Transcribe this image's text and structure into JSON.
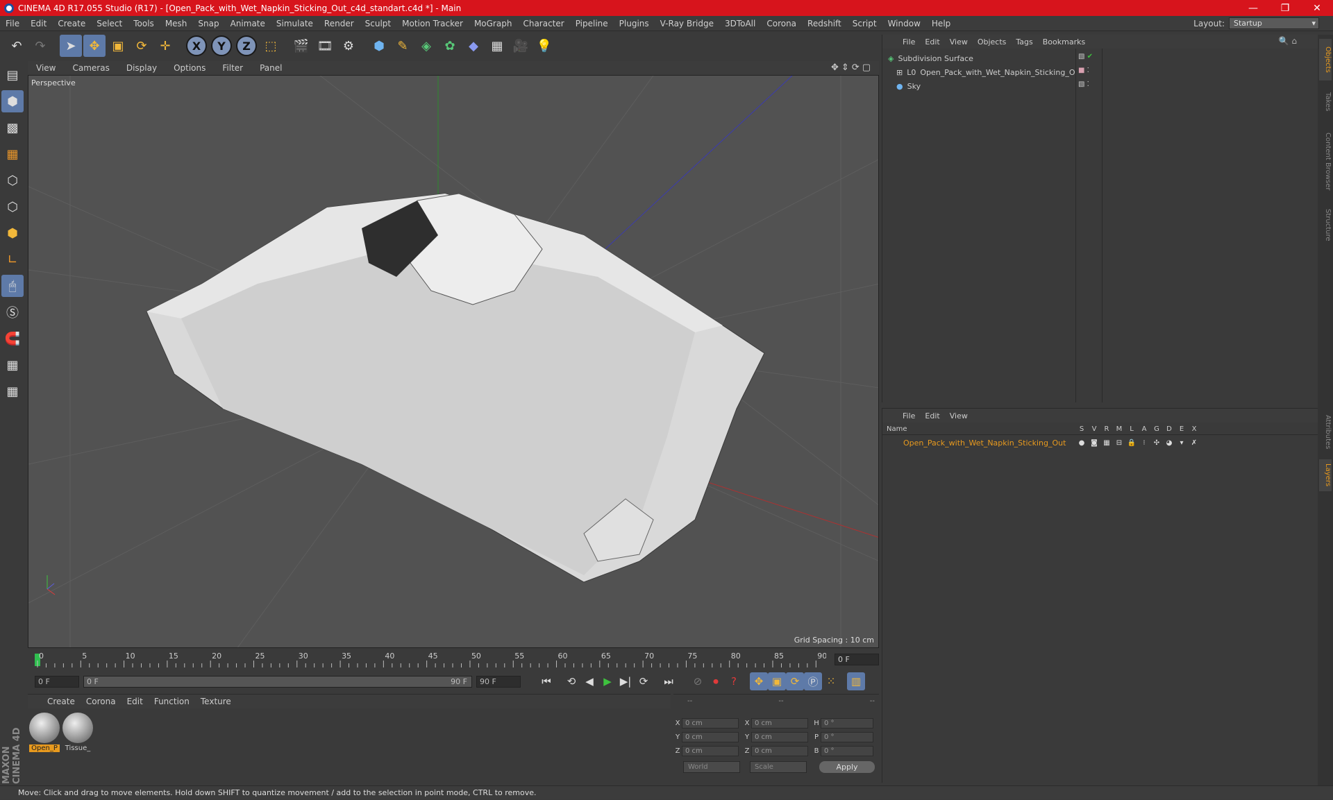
{
  "window": {
    "title": "CINEMA 4D R17.055 Studio (R17) - [Open_Pack_with_Wet_Napkin_Sticking_Out_c4d_standart.c4d *] - Main"
  },
  "menu": [
    "File",
    "Edit",
    "Create",
    "Select",
    "Tools",
    "Mesh",
    "Snap",
    "Animate",
    "Simulate",
    "Render",
    "Sculpt",
    "Motion Tracker",
    "MoGraph",
    "Character",
    "Pipeline",
    "Plugins",
    "V-Ray Bridge",
    "3DToAll",
    "Corona",
    "Redshift",
    "Script",
    "Window",
    "Help"
  ],
  "layout": {
    "label": "Layout:",
    "value": "Startup"
  },
  "toolbar": {
    "axis_x": "X",
    "axis_y": "Y",
    "axis_z": "Z"
  },
  "viewport": {
    "menu": [
      "View",
      "Cameras",
      "Display",
      "Options",
      "Filter",
      "Panel"
    ],
    "label": "Perspective",
    "grid_spacing": "Grid Spacing : 10 cm"
  },
  "timeline": {
    "ticks": [
      "0",
      "5",
      "10",
      "15",
      "20",
      "25",
      "30",
      "35",
      "40",
      "45",
      "50",
      "55",
      "60",
      "65",
      "70",
      "75",
      "80",
      "85",
      "90"
    ],
    "current_frame": "0 F",
    "start": "0 F",
    "range_start": "0 F",
    "range_end": "90 F",
    "end": "90 F"
  },
  "materials": {
    "menu": [
      "Create",
      "Corona",
      "Edit",
      "Function",
      "Texture"
    ],
    "items": [
      {
        "name": "Open_P",
        "selected": true
      },
      {
        "name": "Tissue_",
        "selected": false
      }
    ]
  },
  "coords": {
    "header": [
      "--",
      "--",
      "--"
    ],
    "rows": [
      {
        "a": "X",
        "av": "0 cm",
        "b": "X",
        "bv": "0 cm",
        "c": "H",
        "cv": "0 °"
      },
      {
        "a": "Y",
        "av": "0 cm",
        "b": "Y",
        "bv": "0 cm",
        "c": "P",
        "cv": "0 °"
      },
      {
        "a": "Z",
        "av": "0 cm",
        "b": "Z",
        "bv": "0 cm",
        "c": "B",
        "cv": "0 °"
      }
    ],
    "mode1": "World",
    "mode2": "Scale",
    "apply": "Apply"
  },
  "objects": {
    "menu": [
      "File",
      "Edit",
      "View",
      "Objects",
      "Tags",
      "Bookmarks"
    ],
    "items": [
      {
        "name": "Subdivision Surface"
      },
      {
        "name": "Open_Pack_with_Wet_Napkin_Sticking_Out"
      },
      {
        "name": "Sky"
      }
    ]
  },
  "layers": {
    "menu": [
      "File",
      "Edit",
      "View"
    ],
    "header": {
      "name": "Name",
      "cols": [
        "S",
        "V",
        "R",
        "M",
        "L",
        "A",
        "G",
        "D",
        "E",
        "X"
      ]
    },
    "items": [
      {
        "name": "Open_Pack_with_Wet_Napkin_Sticking_Out"
      }
    ]
  },
  "sidetabs": [
    "Objects",
    "Takes",
    "Content Browser",
    "Structure",
    "Attributes",
    "Layers"
  ],
  "status": "Move: Click and drag to move elements. Hold down SHIFT to quantize movement / add to the selection in point mode, CTRL to remove.",
  "brand": "MAXON CINEMA 4D"
}
